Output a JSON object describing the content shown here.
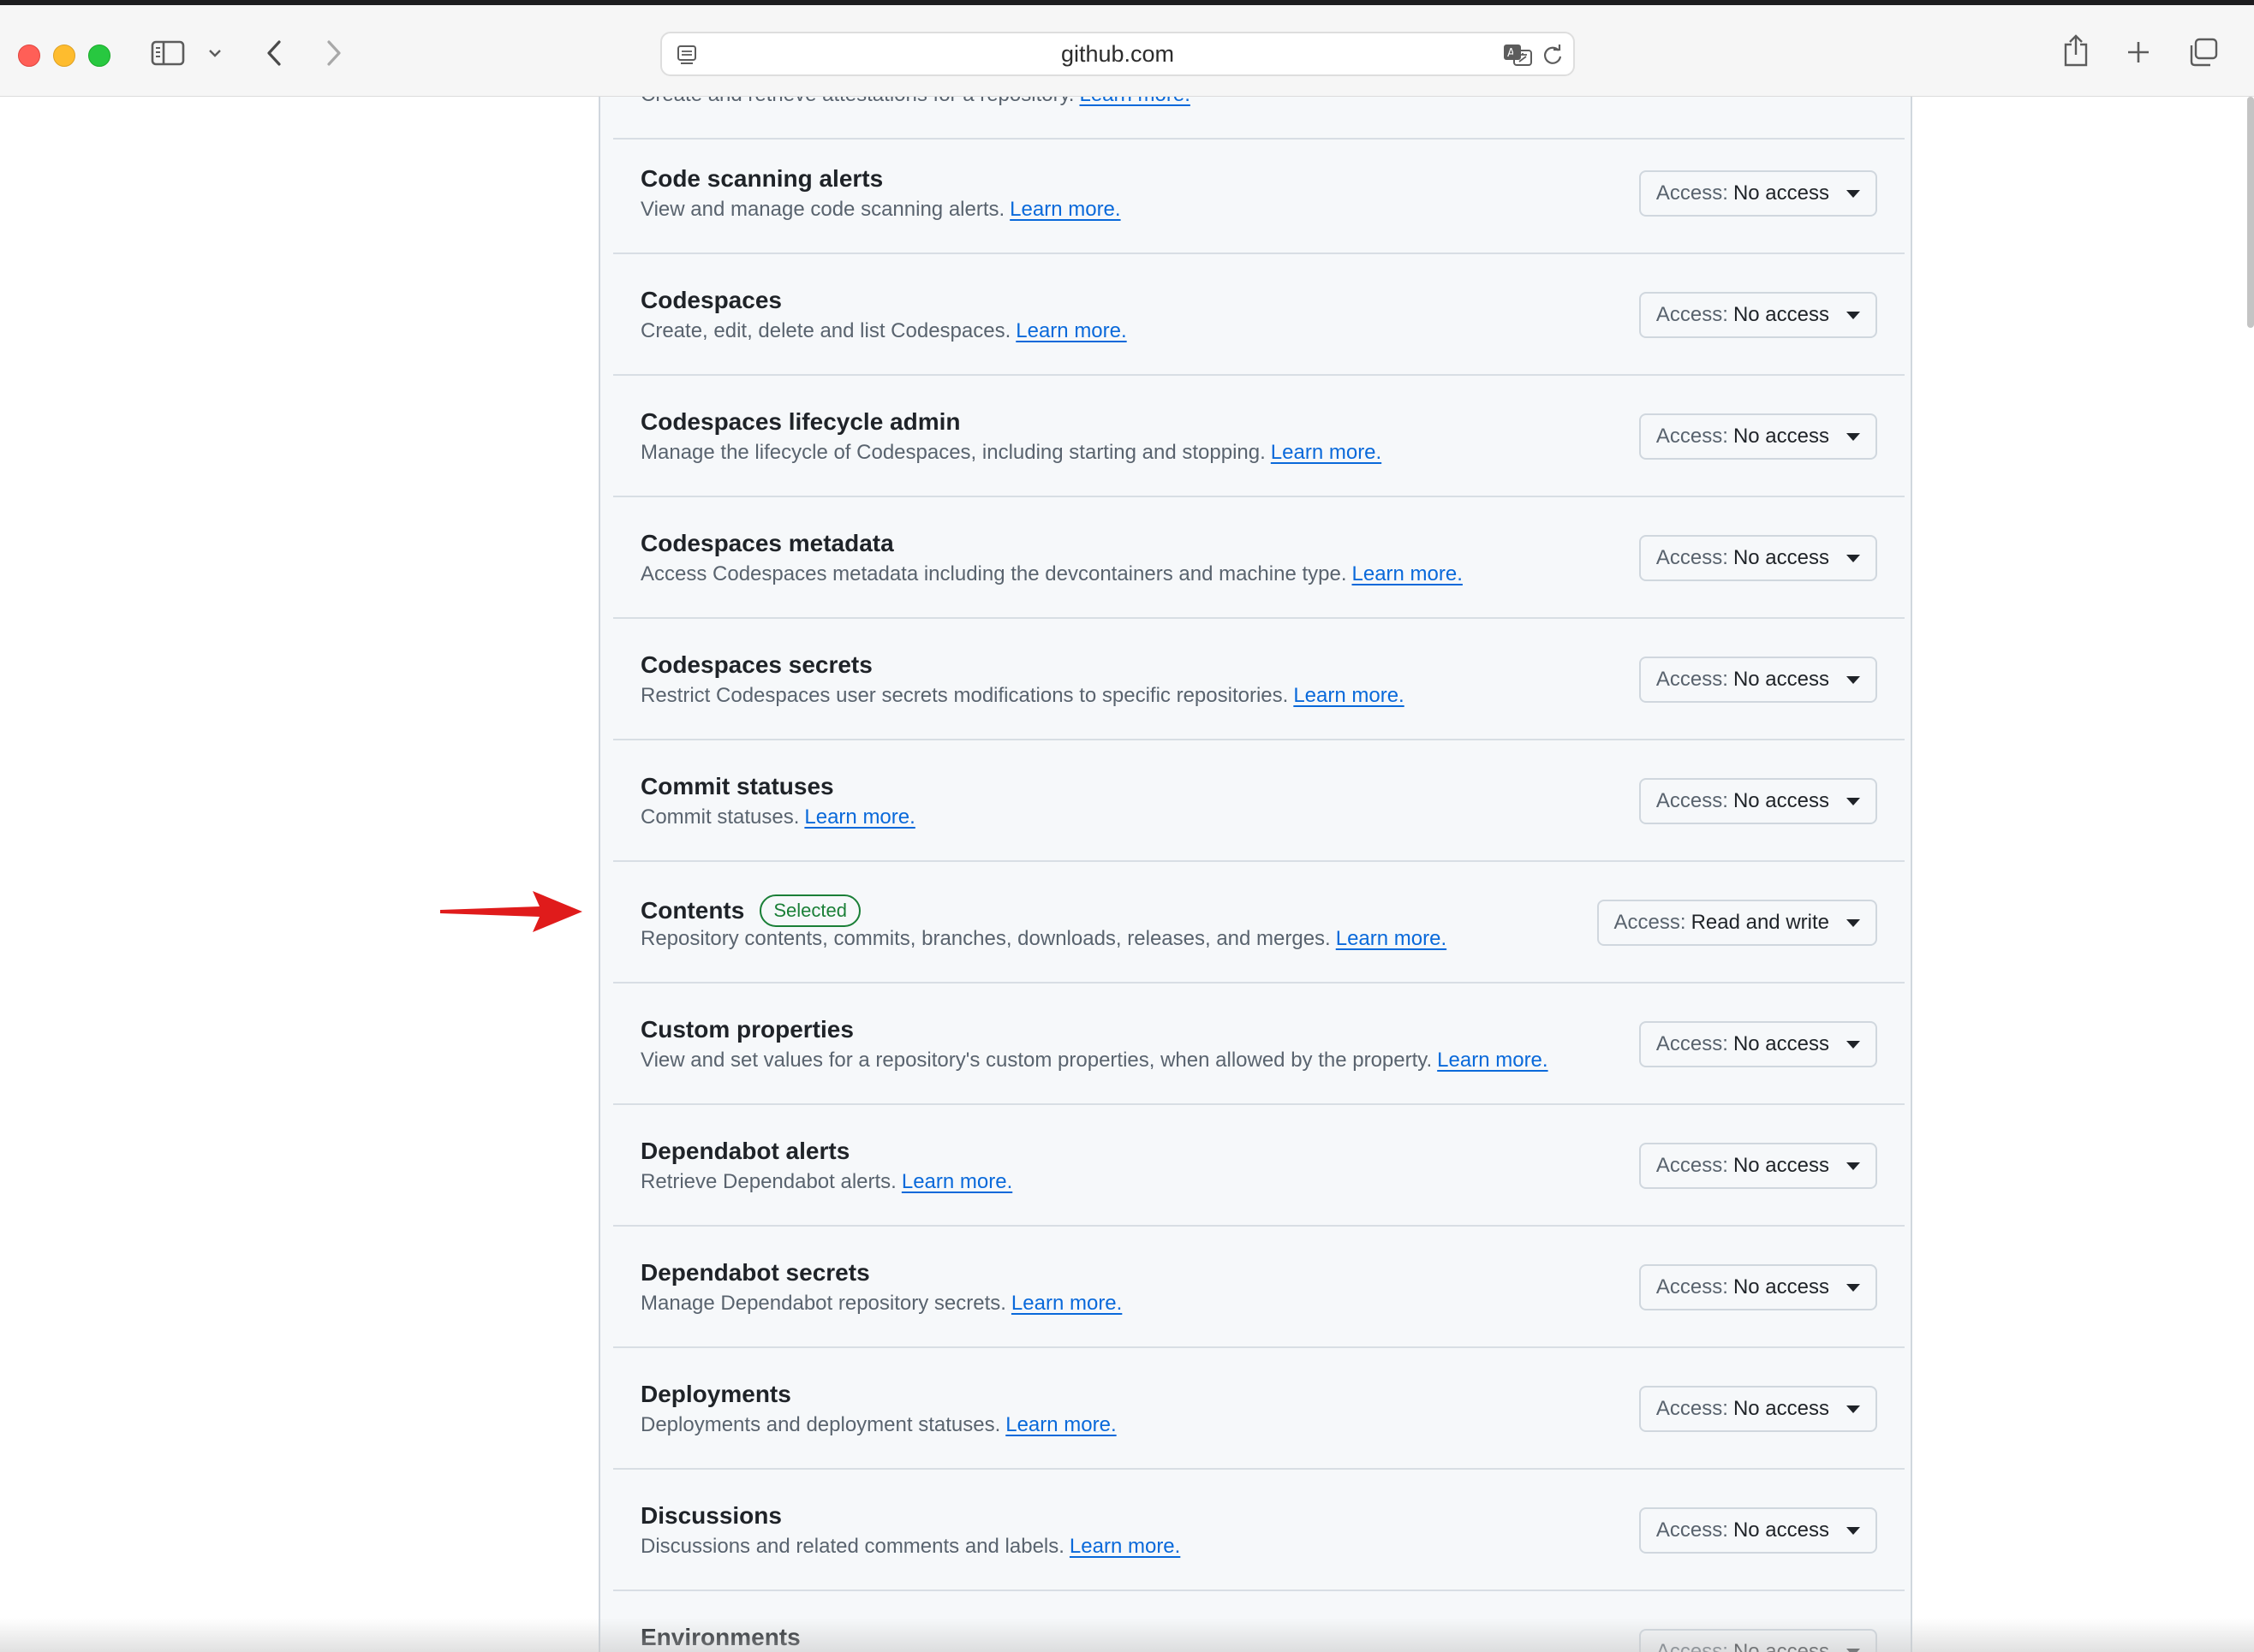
{
  "browser": {
    "url": "github.com"
  },
  "top_partial": {
    "desc": "Create and retrieve attestations for a repository.",
    "link": "Learn more."
  },
  "permissions": [
    {
      "title": "Code scanning alerts",
      "desc": "View and manage code scanning alerts.",
      "link": "Learn more.",
      "access_label": "Access:",
      "access_value": "No access"
    },
    {
      "title": "Codespaces",
      "desc": "Create, edit, delete and list Codespaces.",
      "link": "Learn more.",
      "access_label": "Access:",
      "access_value": "No access"
    },
    {
      "title": "Codespaces lifecycle admin",
      "desc": "Manage the lifecycle of Codespaces, including starting and stopping.",
      "link": "Learn more.",
      "access_label": "Access:",
      "access_value": "No access"
    },
    {
      "title": "Codespaces metadata",
      "desc": "Access Codespaces metadata including the devcontainers and machine type.",
      "link": "Learn more.",
      "access_label": "Access:",
      "access_value": "No access"
    },
    {
      "title": "Codespaces secrets",
      "desc": "Restrict Codespaces user secrets modifications to specific repositories.",
      "link": "Learn more.",
      "access_label": "Access:",
      "access_value": "No access"
    },
    {
      "title": "Commit statuses",
      "desc": "Commit statuses.",
      "link": "Learn more.",
      "access_label": "Access:",
      "access_value": "No access"
    },
    {
      "title": "Contents",
      "badge": "Selected",
      "desc": "Repository contents, commits, branches, downloads, releases, and merges.",
      "link": "Learn more.",
      "access_label": "Access:",
      "access_value": "Read and write"
    },
    {
      "title": "Custom properties",
      "desc": "View and set values for a repository's custom properties, when allowed by the property.",
      "link": "Learn more.",
      "access_label": "Access:",
      "access_value": "No access"
    },
    {
      "title": "Dependabot alerts",
      "desc": "Retrieve Dependabot alerts.",
      "link": "Learn more.",
      "access_label": "Access:",
      "access_value": "No access"
    },
    {
      "title": "Dependabot secrets",
      "desc": "Manage Dependabot repository secrets.",
      "link": "Learn more.",
      "access_label": "Access:",
      "access_value": "No access"
    },
    {
      "title": "Deployments",
      "desc": "Deployments and deployment statuses.",
      "link": "Learn more.",
      "access_label": "Access:",
      "access_value": "No access"
    },
    {
      "title": "Discussions",
      "desc": "Discussions and related comments and labels.",
      "link": "Learn more.",
      "access_label": "Access:",
      "access_value": "No access"
    },
    {
      "title": "Environments",
      "access_label": "Access:",
      "access_value": "No access"
    }
  ],
  "colors": {
    "accent_link": "#0969da",
    "badge_green": "#1a7f37",
    "annotation_arrow": "#e01b1b"
  }
}
